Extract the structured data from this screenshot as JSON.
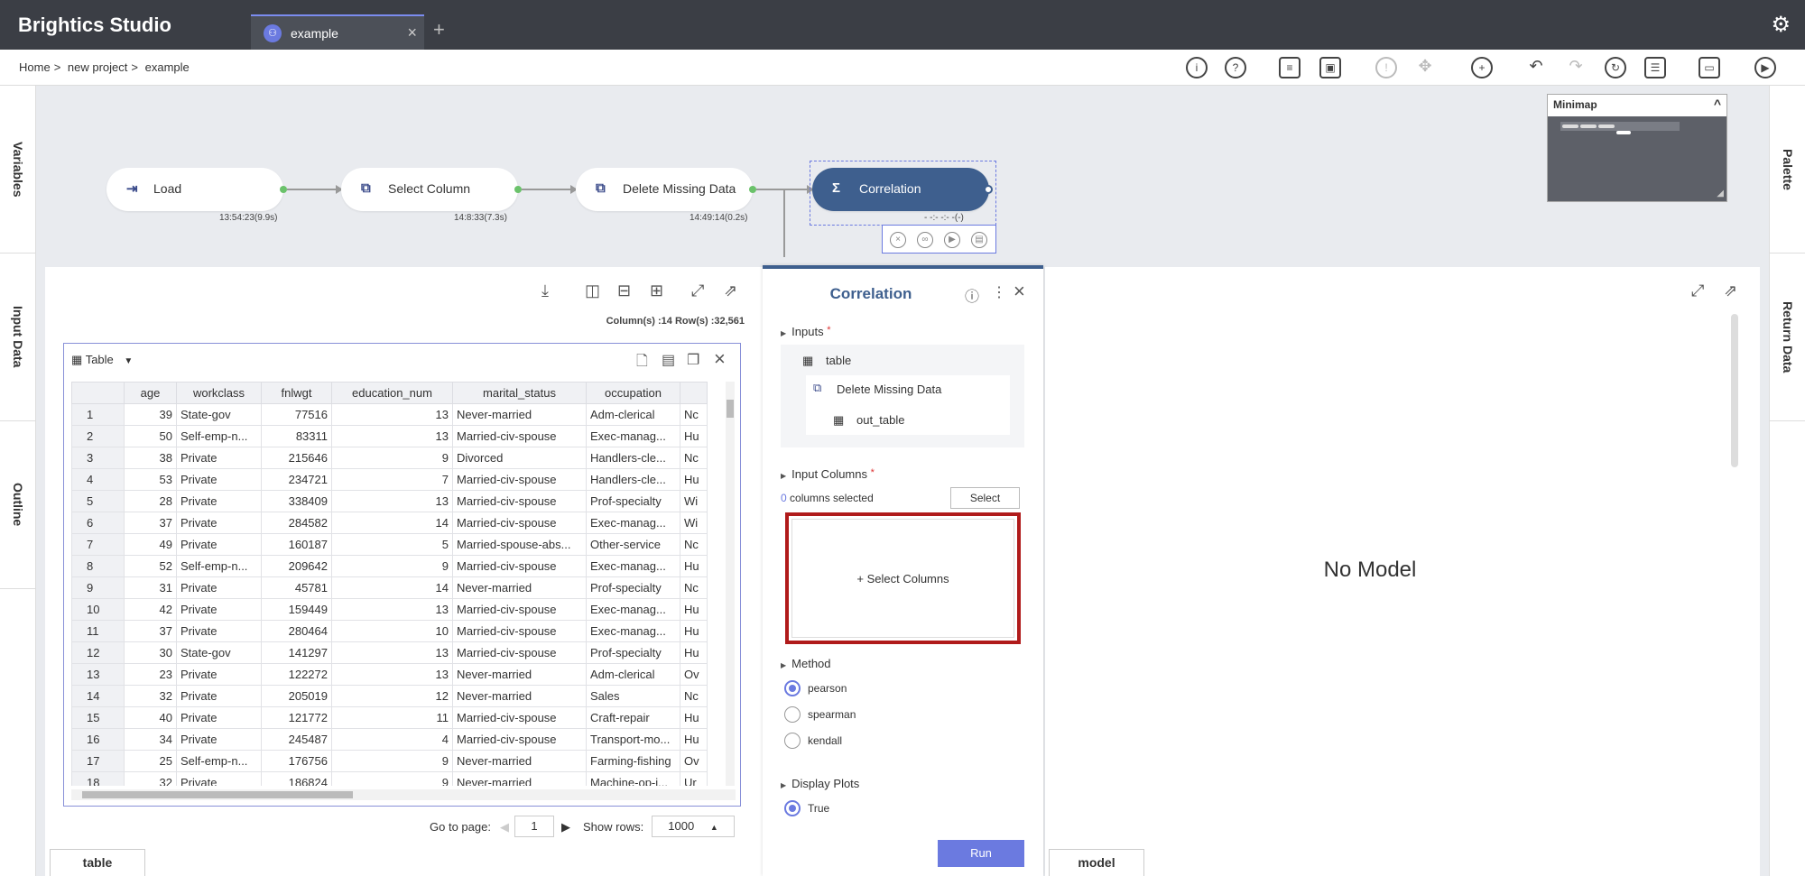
{
  "app": {
    "title": "Brightics Studio"
  },
  "tabs": [
    {
      "label": "example"
    }
  ],
  "new_tab_label": "+",
  "breadcrumb": {
    "items": [
      "Home",
      "new project",
      "example"
    ],
    "separator": ">"
  },
  "left_panels": [
    "Variables",
    "Input Data",
    "Outline"
  ],
  "right_panels": [
    "Palette",
    "Return Data"
  ],
  "workflow": {
    "nodes": [
      {
        "label": "Load",
        "time": "13:54:23(9.9s)"
      },
      {
        "label": "Select Column",
        "time": "14:8:33(7.3s)"
      },
      {
        "label": "Delete Missing Data",
        "time": "14:49:14(0.2s)"
      },
      {
        "label": "Correlation",
        "time": "- -:- -:- -(-)"
      }
    ]
  },
  "minimap": {
    "title": "Minimap"
  },
  "data_view": {
    "counts": "Column(s) :14   Row(s) :32,561",
    "view_label": "Table",
    "columns": [
      "",
      "age",
      "workclass",
      "fnlwgt",
      "education_num",
      "marital_status",
      "occupation",
      ""
    ],
    "rows": [
      [
        "1",
        "39",
        "State-gov",
        "77516",
        "13",
        "Never-married",
        "Adm-clerical",
        "Nc"
      ],
      [
        "2",
        "50",
        "Self-emp-n...",
        "83311",
        "13",
        "Married-civ-spouse",
        "Exec-manag...",
        "Hu"
      ],
      [
        "3",
        "38",
        "Private",
        "215646",
        "9",
        "Divorced",
        "Handlers-cle...",
        "Nc"
      ],
      [
        "4",
        "53",
        "Private",
        "234721",
        "7",
        "Married-civ-spouse",
        "Handlers-cle...",
        "Hu"
      ],
      [
        "5",
        "28",
        "Private",
        "338409",
        "13",
        "Married-civ-spouse",
        "Prof-specialty",
        "Wi"
      ],
      [
        "6",
        "37",
        "Private",
        "284582",
        "14",
        "Married-civ-spouse",
        "Exec-manag...",
        "Wi"
      ],
      [
        "7",
        "49",
        "Private",
        "160187",
        "5",
        "Married-spouse-abs...",
        "Other-service",
        "Nc"
      ],
      [
        "8",
        "52",
        "Self-emp-n...",
        "209642",
        "9",
        "Married-civ-spouse",
        "Exec-manag...",
        "Hu"
      ],
      [
        "9",
        "31",
        "Private",
        "45781",
        "14",
        "Never-married",
        "Prof-specialty",
        "Nc"
      ],
      [
        "10",
        "42",
        "Private",
        "159449",
        "13",
        "Married-civ-spouse",
        "Exec-manag...",
        "Hu"
      ],
      [
        "11",
        "37",
        "Private",
        "280464",
        "10",
        "Married-civ-spouse",
        "Exec-manag...",
        "Hu"
      ],
      [
        "12",
        "30",
        "State-gov",
        "141297",
        "13",
        "Married-civ-spouse",
        "Prof-specialty",
        "Hu"
      ],
      [
        "13",
        "23",
        "Private",
        "122272",
        "13",
        "Never-married",
        "Adm-clerical",
        "Ov"
      ],
      [
        "14",
        "32",
        "Private",
        "205019",
        "12",
        "Never-married",
        "Sales",
        "Nc"
      ],
      [
        "15",
        "40",
        "Private",
        "121772",
        "11",
        "Married-civ-spouse",
        "Craft-repair",
        "Hu"
      ],
      [
        "16",
        "34",
        "Private",
        "245487",
        "4",
        "Married-civ-spouse",
        "Transport-mo...",
        "Hu"
      ],
      [
        "17",
        "25",
        "Self-emp-n...",
        "176756",
        "9",
        "Never-married",
        "Farming-fishing",
        "Ov"
      ],
      [
        "18",
        "32",
        "Private",
        "186824",
        "9",
        "Never-married",
        "Machine-op-i...",
        "Ur"
      ]
    ],
    "pager": {
      "goto_label": "Go to page:",
      "page": "1",
      "show_rows_label": "Show rows:",
      "show_rows": "1000"
    },
    "bottom_tab": "table"
  },
  "properties": {
    "title": "Correlation",
    "inputs_label": "Inputs",
    "input_table": "table",
    "source_node": "Delete Missing Data",
    "source_output": "out_table",
    "input_columns_label": "Input Columns",
    "columns_selected_count": "0",
    "columns_selected_text": "columns selected",
    "select_button": "Select",
    "select_columns_placeholder": "+ Select Columns",
    "method_label": "Method",
    "methods": [
      "pearson",
      "spearman",
      "kendall"
    ],
    "method_selected": "pearson",
    "display_plots_label": "Display Plots",
    "display_plots_value": "True",
    "run_button": "Run"
  },
  "model_view": {
    "empty_text": "No Model",
    "bottom_tab": "model"
  },
  "colors": {
    "accent": "#6b7ae0",
    "node_selected": "#3e5f8e",
    "highlight": "#b01b1b",
    "topbar": "#3b3e45"
  }
}
